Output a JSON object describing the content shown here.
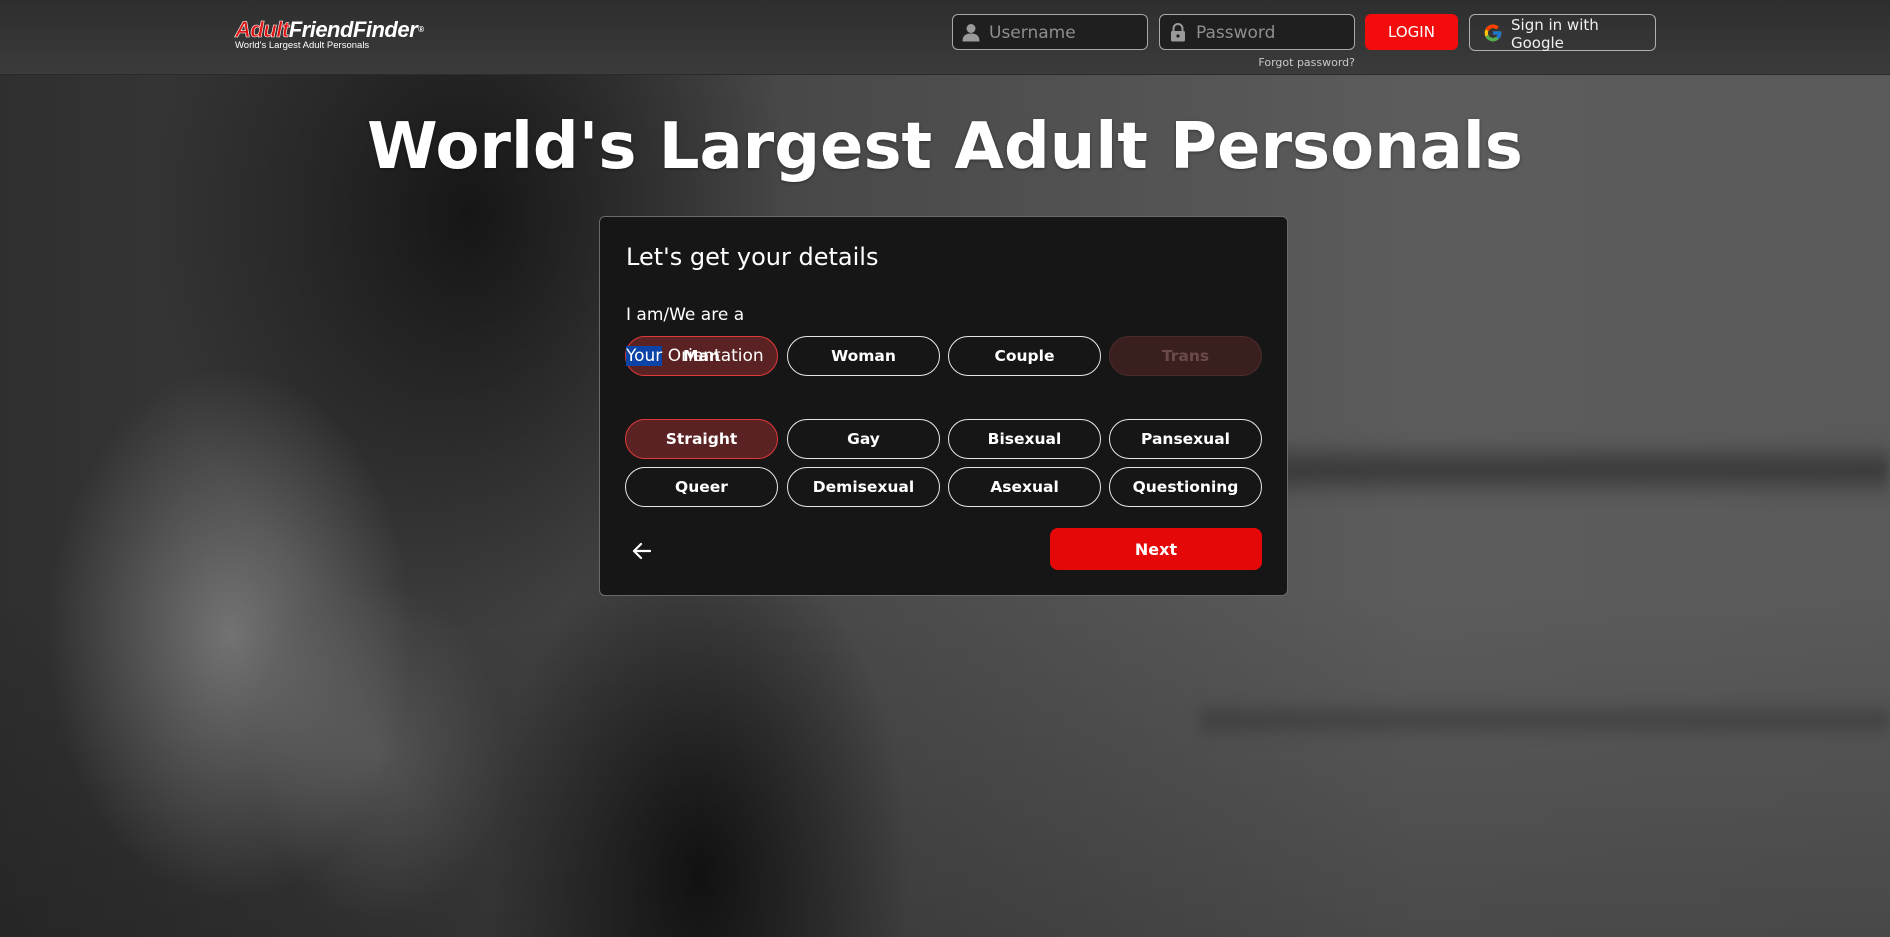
{
  "header": {
    "logo": {
      "part1": "Adult",
      "part2": "FriendFinder",
      "registered": "®",
      "tagline": "World's Largest Adult Personals"
    },
    "username_placeholder": "Username",
    "password_placeholder": "Password",
    "login_label": "LOGIN",
    "google_label": "Sign in with Google",
    "forgot_label": "Forgot password?"
  },
  "headline": "World's Largest Adult Personals",
  "card": {
    "title": "Let's get your details",
    "identity_label": "I am/We are a",
    "identity_options": [
      {
        "label": "Man",
        "state": "selected"
      },
      {
        "label": "Woman",
        "state": "default"
      },
      {
        "label": "Couple",
        "state": "default"
      },
      {
        "label": "Trans",
        "state": "disabled"
      }
    ],
    "orientation_label_highlighted": "Your",
    "orientation_label_rest": " Orientation",
    "orientation_options": [
      {
        "label": "Straight",
        "state": "selected"
      },
      {
        "label": "Gay",
        "state": "default"
      },
      {
        "label": "Bisexual",
        "state": "default"
      },
      {
        "label": "Pansexual",
        "state": "default"
      },
      {
        "label": "Queer",
        "state": "default"
      },
      {
        "label": "Demisexual",
        "state": "default"
      },
      {
        "label": "Asexual",
        "state": "default"
      },
      {
        "label": "Questioning",
        "state": "default"
      }
    ],
    "next_label": "Next"
  },
  "colors": {
    "brand_red": "#e50808",
    "selected_fill": "#5a2222",
    "selected_border": "#e23a3a",
    "selection_highlight": "#0b43a6"
  },
  "icons": {
    "username": "user-icon",
    "password": "lock-icon",
    "google": "google-g-icon",
    "back": "arrow-left-icon"
  }
}
